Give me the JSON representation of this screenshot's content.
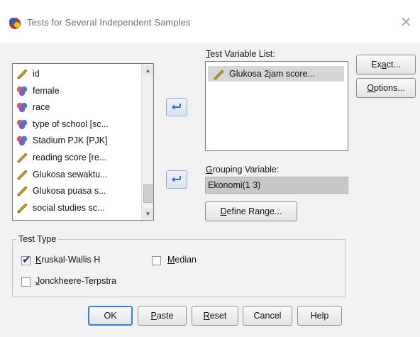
{
  "window": {
    "title": "Tests for Several Independent Samples",
    "close_icon": "close-icon"
  },
  "source_list": {
    "items": [
      {
        "label": "id",
        "icon": "scale-variable-icon"
      },
      {
        "label": "female",
        "icon": "nominal-variable-icon"
      },
      {
        "label": "race",
        "icon": "nominal-variable-icon"
      },
      {
        "label": "type of school [sc...",
        "icon": "nominal-variable-icon"
      },
      {
        "label": "Stadium PJK [PJK]",
        "icon": "nominal-variable-icon"
      },
      {
        "label": "reading score [re...",
        "icon": "scale-variable-icon"
      },
      {
        "label": "Glukosa sewaktu...",
        "icon": "scale-variable-icon"
      },
      {
        "label": "Glukosa puasa s...",
        "icon": "scale-variable-icon"
      },
      {
        "label": "social studies sc...",
        "icon": "scale-variable-icon"
      }
    ]
  },
  "test_variable": {
    "label_u": "T",
    "label_rest": "est Variable List:",
    "items": [
      {
        "label": "Glukosa 2jam score...",
        "icon": "scale-variable-icon"
      }
    ]
  },
  "grouping": {
    "label_u": "G",
    "label_rest": "rouping Variable:",
    "value": "Ekonomi(1 3)",
    "define_u": "D",
    "define_rest": "efine Range..."
  },
  "side_buttons": {
    "exact_pre": "Ex",
    "exact_u": "a",
    "exact_post": "ct...",
    "options_u": "O",
    "options_rest": "ptions..."
  },
  "test_type": {
    "legend": "Test Type",
    "kruskal_u": "K",
    "kruskal_rest": "ruskal-Wallis H",
    "kruskal_checked": true,
    "median_u": "M",
    "median_rest": "edian",
    "median_checked": false,
    "jonck_u": "J",
    "jonck_rest": "onckheere-Terpstra",
    "jonck_checked": false
  },
  "footer": {
    "ok": "OK",
    "paste_u": "P",
    "paste_rest": "aste",
    "reset_u": "R",
    "reset_rest": "eset",
    "cancel": "Cancel",
    "help": "Help"
  },
  "colors": {
    "arrow_blue": "#2f6fd0",
    "nominal_red": "#e05a4f",
    "nominal_blue": "#4a78d6",
    "scale_gold": "#c9a227"
  }
}
